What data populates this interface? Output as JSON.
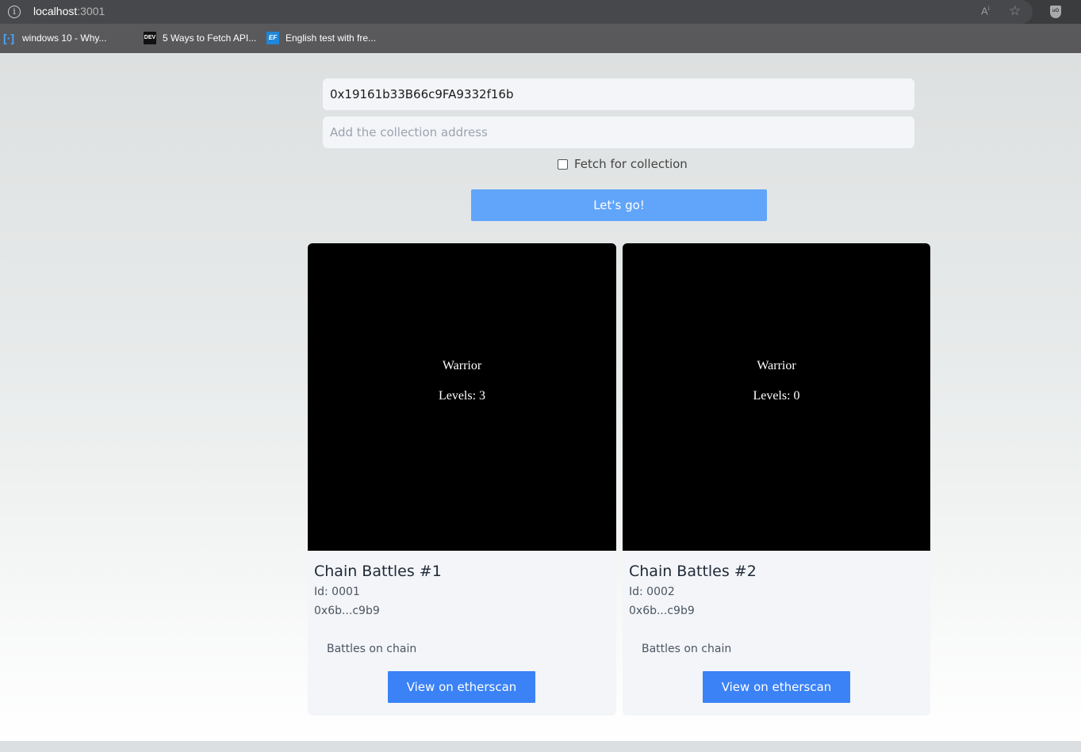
{
  "browser": {
    "url_host": "localhost",
    "url_port": ":3001",
    "bookmarks": [
      {
        "label": "windows 10 - Why...",
        "icon": "bracket-icon"
      },
      {
        "label": "",
        "icon": "page-icon"
      },
      {
        "label": "5 Ways to Fetch API...",
        "icon": "dev-icon"
      },
      {
        "label": "English test with fre...",
        "icon": "ef-icon"
      }
    ]
  },
  "form": {
    "wallet_value": "0x19161b33B66c9FA9332f16b",
    "collection_placeholder": "Add the collection address",
    "fetch_label": "Fetch for collection",
    "fetch_checked": false,
    "submit_label": "Let's go!"
  },
  "nfts": [
    {
      "image_name": "Warrior",
      "image_level": "Levels: 3",
      "title": "Chain Battles #1",
      "id": "Id: 0001",
      "address": "0x6b...c9b9",
      "description": "Battles on chain",
      "button_label": "View on etherscan"
    },
    {
      "image_name": "Warrior",
      "image_level": "Levels: 0",
      "title": "Chain Battles #2",
      "id": "Id: 0002",
      "address": "0x6b...c9b9",
      "description": "Battles on chain",
      "button_label": "View on etherscan"
    }
  ],
  "colors": {
    "primary_button": "#60a5fa",
    "etherscan_button": "#3b82f6",
    "nft_background": "#000000"
  }
}
